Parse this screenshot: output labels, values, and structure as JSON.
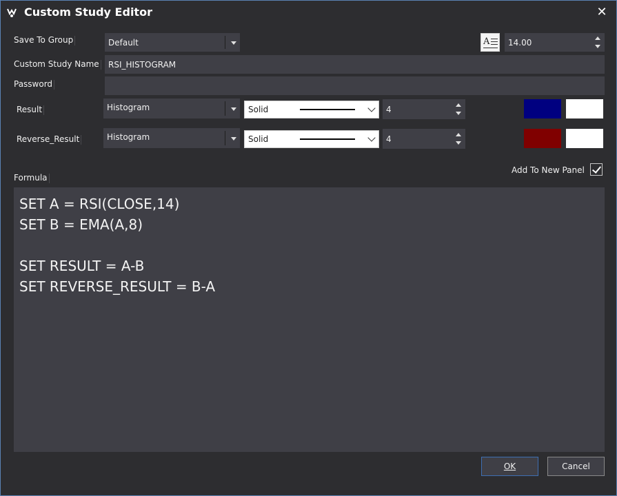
{
  "window": {
    "title": "Custom Study Editor",
    "close_label": "✕"
  },
  "group": {
    "label": "Save To Group",
    "value": "Default"
  },
  "font_size": {
    "value": "14.00"
  },
  "name": {
    "label": "Custom Study Name",
    "value": "RSI_HISTOGRAM"
  },
  "password": {
    "label": "Password",
    "value": ""
  },
  "rows": [
    {
      "label": "Result",
      "chart_type": "Histogram",
      "line_style": "Solid",
      "thickness": "4",
      "color1": "#000080",
      "color2": "#ffffff"
    },
    {
      "label": "Reverse_Result",
      "chart_type": "Histogram",
      "line_style": "Solid",
      "thickness": "4",
      "color1": "#800000",
      "color2": "#ffffff"
    }
  ],
  "formula": {
    "label": "Formula",
    "text": "SET A = RSI(CLOSE,14)\nSET B = EMA(A,8)\n\nSET RESULT = A-B\nSET REVERSE_RESULT = B-A"
  },
  "add_to_new_panel": {
    "label": "Add To New Panel",
    "checked": true
  },
  "buttons": {
    "ok": "OK",
    "cancel": "Cancel"
  }
}
